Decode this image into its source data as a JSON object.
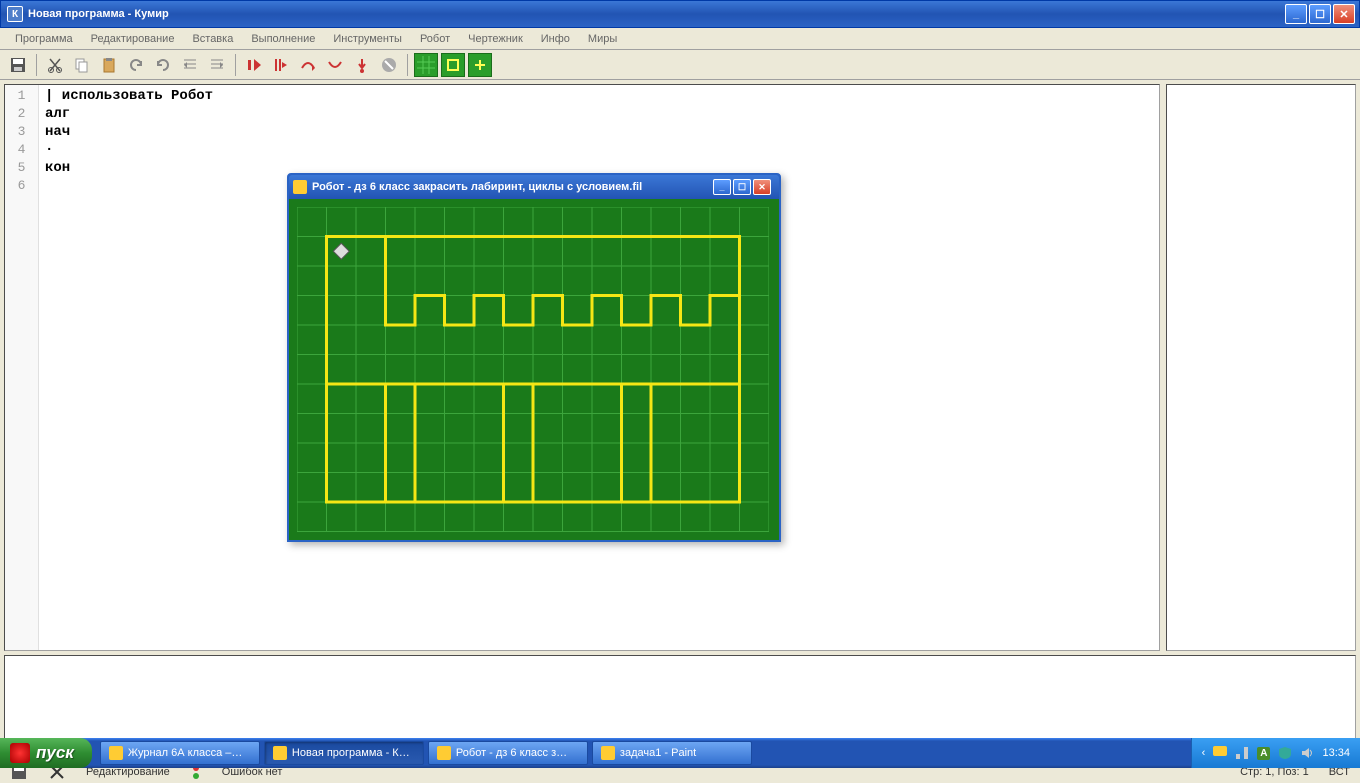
{
  "window": {
    "title": "Новая программа - Кумир",
    "icon_letter": "К"
  },
  "menu": {
    "items": [
      "Программа",
      "Редактирование",
      "Вставка",
      "Выполнение",
      "Инструменты",
      "Робот",
      "Чертежник",
      "Инфо",
      "Миры"
    ]
  },
  "editor": {
    "line_numbers": [
      "1",
      "2",
      "3",
      "4",
      "5",
      "6"
    ],
    "lines": [
      "| использовать Робот",
      "алг",
      "нач",
      "·",
      "кон",
      ""
    ]
  },
  "robot_window": {
    "title": "Робот - дз 6 класс закрасить лабиринт, циклы с условием.fil",
    "cols": 16,
    "rows": 11,
    "robot_pos": {
      "col": 1,
      "row": 1
    }
  },
  "bottom_bar": {
    "save_icon": "save",
    "mode": "Редактирование",
    "errors": "Ошибок нет",
    "position": "Стр: 1, Поз: 1",
    "insert_mode": "ВСТ"
  },
  "taskbar": {
    "start": "пуск",
    "tasks": [
      {
        "label": "Журнал 6А класса –…",
        "icon": "y"
      },
      {
        "label": "Новая программа - К…",
        "icon": "k",
        "active": true
      },
      {
        "label": "Робот - дз 6 класс з…",
        "icon": "r"
      },
      {
        "label": "задача1 - Paint",
        "icon": "p"
      }
    ],
    "lang": "А",
    "clock": "13:34"
  }
}
